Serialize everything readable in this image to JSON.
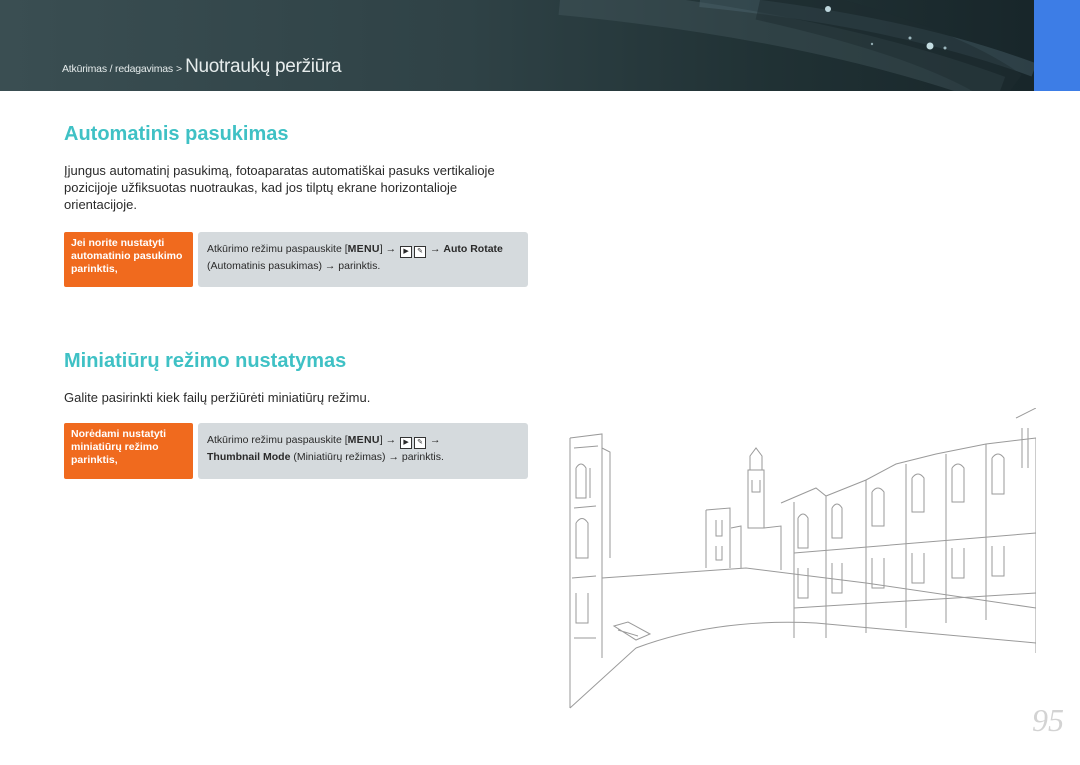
{
  "header": {
    "breadcrumb_path": "Atkūrimas / redagavimas",
    "breadcrumb_separator": ">",
    "section_title": "Nuotraukų peržiūra",
    "accent_color": "#3d7de6"
  },
  "section1": {
    "title": "Automatinis pasukimas",
    "paragraph": "Įjungus automatinį pasukimą, fotoaparatas automatiškai pasuks vertikalioje pozicijoje užfiksuotas nuotraukas, kad jos tilptų ekrane horizontalioje orientacijoje.",
    "tip_label": "Jei norite nustatyti automatinio pasukimo parinktis,",
    "tip_text_1": "Atkūrimo režimu paspauskite [",
    "menu_key": "MENU",
    "tip_text_2": "] →",
    "tip_text_3": "→ ",
    "tip_bold_1": "Auto Rotate",
    "tip_text_4": " (Automatinis pasukimas) → parinktis."
  },
  "section2": {
    "title": "Miniatiūrų režimo nustatymas",
    "paragraph": "Galite pasirinkti kiek failų peržiūrėti miniatiūrų režimu.",
    "tip_label": "Norėdami nustatyti miniatiūrų režimo parinktis,",
    "tip_text_1": "Atkūrimo režimu paspauskite [",
    "menu_key": "MENU",
    "tip_text_2": "] →",
    "tip_text_3": "→",
    "tip_bold_1": "Thumbnail Mode",
    "tip_text_4": " (Miniatiūrų režimas) → parinktis."
  },
  "page_number": "95",
  "colors": {
    "heading": "#3fc1c5",
    "tip_label_bg": "#f06a1e",
    "tip_box_bg": "#d5dadd"
  }
}
